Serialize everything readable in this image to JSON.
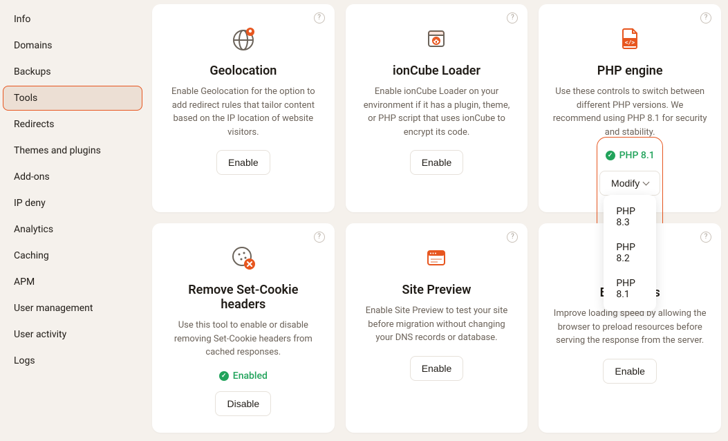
{
  "sidebar": {
    "items": [
      {
        "label": "Info",
        "active": false
      },
      {
        "label": "Domains",
        "active": false
      },
      {
        "label": "Backups",
        "active": false
      },
      {
        "label": "Tools",
        "active": true
      },
      {
        "label": "Redirects",
        "active": false
      },
      {
        "label": "Themes and plugins",
        "active": false
      },
      {
        "label": "Add-ons",
        "active": false
      },
      {
        "label": "IP deny",
        "active": false
      },
      {
        "label": "Analytics",
        "active": false
      },
      {
        "label": "Caching",
        "active": false
      },
      {
        "label": "APM",
        "active": false
      },
      {
        "label": "User management",
        "active": false
      },
      {
        "label": "User activity",
        "active": false
      },
      {
        "label": "Logs",
        "active": false
      }
    ]
  },
  "cards": {
    "geolocation": {
      "title": "Geolocation",
      "desc": "Enable Geolocation for the option to add redirect rules that tailor content based on the IP location of website visitors.",
      "button": "Enable"
    },
    "ioncube": {
      "title": "ionCube Loader",
      "desc": "Enable ionCube Loader on your environment if it has a plugin, theme, or PHP script that uses ionCube to encrypt its code.",
      "button": "Enable"
    },
    "php": {
      "title": "PHP engine",
      "desc": "Use these controls to switch between different PHP versions. We recommend using PHP 8.1 for security and stability.",
      "status": "PHP 8.1",
      "button": "Modify",
      "options": [
        "PHP 8.3",
        "PHP 8.2",
        "PHP 8.1"
      ]
    },
    "cookie": {
      "title": "Remove Set-Cookie headers",
      "desc": "Use this tool to enable or disable removing Set-Cookie headers from cached responses.",
      "status": "Enabled",
      "button": "Disable"
    },
    "preview": {
      "title": "Site Preview",
      "desc": "Enable Site Preview to test your site before migration without changing your DNS records or database.",
      "button": "Enable"
    },
    "early": {
      "title": "Early Hints",
      "desc": "Improve loading speed by allowing the browser to preload resources before serving the response from the server.",
      "button": "Enable"
    }
  },
  "help_glyph": "?"
}
